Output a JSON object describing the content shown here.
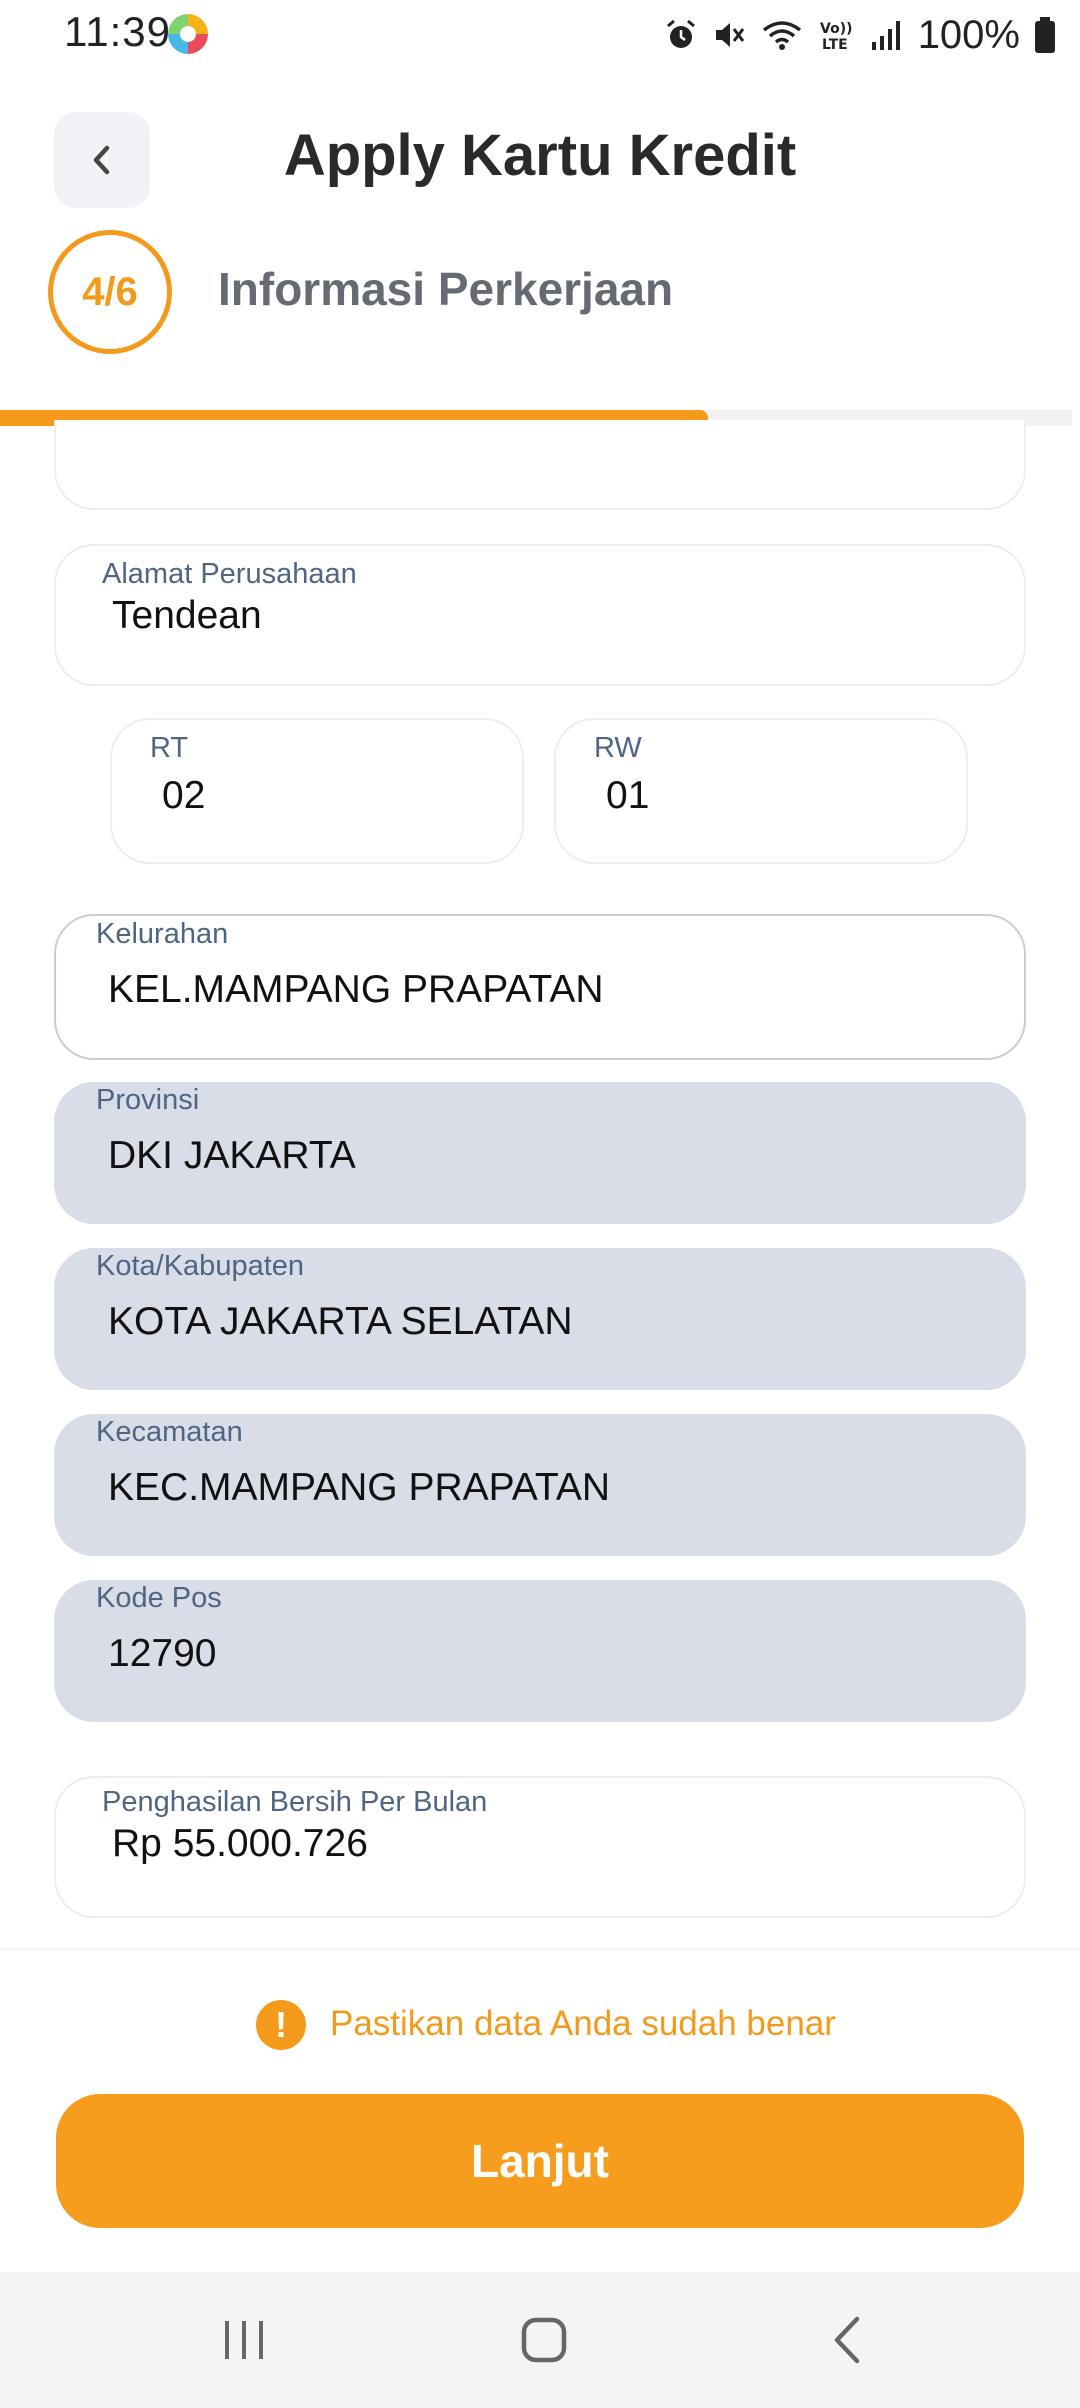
{
  "status": {
    "time": "11:39",
    "battery": "100%",
    "icons": [
      "alarm-icon",
      "mute-icon",
      "wifi-icon",
      "volte-icon",
      "signal-icon",
      "battery-icon"
    ]
  },
  "header": {
    "title": "Apply Kartu Kredit",
    "step": "4/6",
    "step_title": "Informasi Perkerjaan",
    "progress": 0.66
  },
  "form": {
    "alamat_label": "Alamat Perusahaan",
    "alamat_value": "Tendean",
    "rt_label": "RT",
    "rt_value": "02",
    "rw_label": "RW",
    "rw_value": "01",
    "kelurahan_label": "Kelurahan",
    "kelurahan_value": "KEL.MAMPANG PRAPATAN",
    "provinsi_label": "Provinsi",
    "provinsi_value": "DKI JAKARTA",
    "kota_label": "Kota/Kabupaten",
    "kota_value": "KOTA JAKARTA SELATAN",
    "kecamatan_label": "Kecamatan",
    "kecamatan_value": "KEC.MAMPANG PRAPATAN",
    "kodepos_label": "Kode Pos",
    "kodepos_value": "12790",
    "penghasilan_label": "Penghasilan Bersih Per Bulan",
    "penghasilan_value": "Rp 55.000.726"
  },
  "notice": {
    "icon": "!",
    "text": "Pastikan data Anda sudah benar"
  },
  "actions": {
    "next_label": "Lanjut"
  },
  "colors": {
    "accent": "#f79d1d",
    "disabled_field": "#d9dde8",
    "label": "#4f6583"
  }
}
